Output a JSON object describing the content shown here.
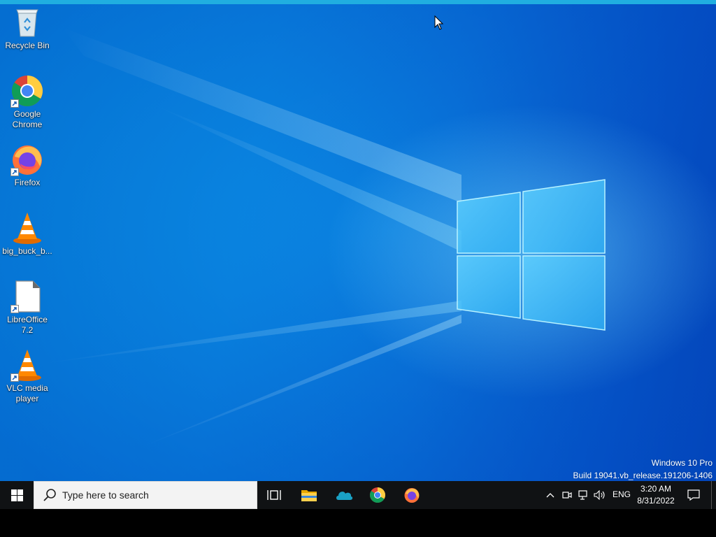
{
  "desktop": {
    "icons": [
      {
        "label": "Recycle Bin",
        "icon": "recycle-bin-icon"
      },
      {
        "label": "Google\nChrome",
        "icon": "chrome-icon"
      },
      {
        "label": "Firefox",
        "icon": "firefox-icon"
      },
      {
        "label": "big_buck_b...",
        "icon": "vlc-file-icon"
      },
      {
        "label": "LibreOffice\n7.2",
        "icon": "libreoffice-icon"
      },
      {
        "label": "VLC media\nplayer",
        "icon": "vlc-icon"
      }
    ],
    "watermark": {
      "line1": "Windows 10 Pro",
      "line2": "Build 19041.vb_release.191206-1406"
    }
  },
  "taskbar": {
    "search_placeholder": "Type here to search",
    "pinned": [
      "task-view-icon",
      "file-explorer-icon",
      "onedrive-icon",
      "chrome-icon",
      "firefox-icon"
    ],
    "tray": {
      "language": "ENG",
      "time": "3:20 AM",
      "date": "8/31/2022"
    }
  },
  "colors": {
    "taskbar": "#101214",
    "wallpaper_accent": "#0a8fe6"
  }
}
